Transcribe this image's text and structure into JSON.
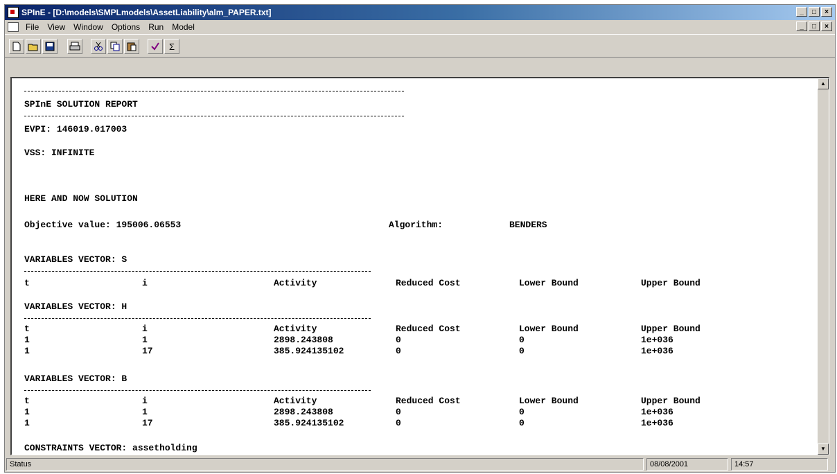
{
  "window": {
    "title": "SPInE - [D:\\models\\SMPLmodels\\AssetLiability\\alm_PAPER.txt]",
    "buttons": [
      "_",
      "□",
      "×"
    ]
  },
  "menu": [
    "File",
    "View",
    "Window",
    "Options",
    "Run",
    "Model"
  ],
  "toolbar": {
    "icons": [
      "new-icon",
      "open-icon",
      "save-icon",
      "print-icon",
      "cut-icon",
      "copy-icon",
      "paste-icon",
      "check-icon",
      "sigma-icon"
    ],
    "sigma_label": "Σ"
  },
  "report": {
    "title": "SPInE SOLUTION REPORT",
    "evpi": "EVPI: 146019.017003",
    "vss": "VSS: INFINITE",
    "here_now": "HERE AND NOW SOLUTION",
    "objective": "Objective value: 195006.06553",
    "algorithm_label": "Algorithm:",
    "algorithm_value": "BENDERS",
    "headers": [
      "t",
      "i",
      "Activity",
      "Reduced Cost",
      "Lower Bound",
      "Upper Bound"
    ],
    "vectors": [
      {
        "label": "VARIABLES VECTOR: S",
        "rows": []
      },
      {
        "label": "VARIABLES VECTOR: H",
        "rows": [
          [
            "1",
            "1",
            "2898.243808",
            "0",
            "0",
            "1e+036"
          ],
          [
            "1",
            "17",
            "385.924135102",
            "0",
            "0",
            "1e+036"
          ]
        ]
      },
      {
        "label": "VARIABLES VECTOR: B",
        "rows": [
          [
            "1",
            "1",
            "2898.243808",
            "0",
            "0",
            "1e+036"
          ],
          [
            "1",
            "17",
            "385.924135102",
            "0",
            "0",
            "1e+036"
          ]
        ]
      }
    ],
    "constraints": "CONSTRAINTS VECTOR: assetholding"
  },
  "statusbar": {
    "status": "Status",
    "date": "08/08/2001",
    "time": "14:57"
  }
}
